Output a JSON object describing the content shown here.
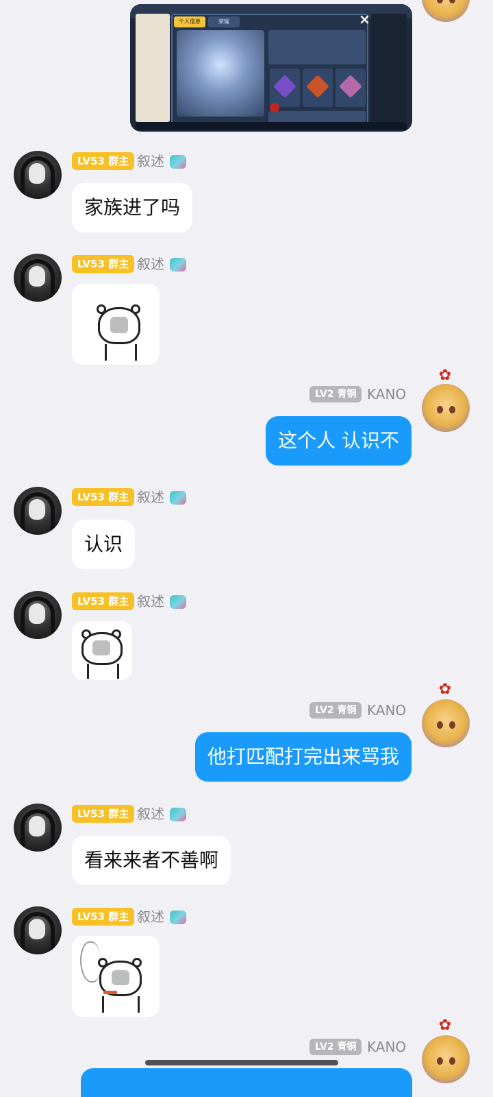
{
  "messages": [
    {
      "type": "image",
      "side": "out",
      "image_label": "game-screenshot"
    },
    {
      "type": "text",
      "side": "in",
      "badge": "LV53 群主",
      "sender": "叙述",
      "text": "家族进了吗"
    },
    {
      "type": "sticker",
      "side": "in",
      "badge": "LV53 群主",
      "sender": "叙述",
      "sticker": "bear-meme-sticker"
    },
    {
      "type": "text",
      "side": "out",
      "badge": "LV2 青铜",
      "sender": "KANO",
      "text": "这个人 认识不"
    },
    {
      "type": "text",
      "side": "in",
      "badge": "LV53 群主",
      "sender": "叙述",
      "text": "认识"
    },
    {
      "type": "sticker",
      "side": "in",
      "badge": "LV53 群主",
      "sender": "叙述",
      "sticker": "bear-meme-sticker"
    },
    {
      "type": "text",
      "side": "out",
      "badge": "LV2 青铜",
      "sender": "KANO",
      "text": "他打匹配打完出来骂我"
    },
    {
      "type": "text",
      "side": "in",
      "badge": "LV53 群主",
      "sender": "叙述",
      "text": "看来来者不善啊"
    },
    {
      "type": "sticker",
      "side": "in",
      "badge": "LV53 群主",
      "sender": "叙述",
      "sticker": "smoking-bear-meme-sticker"
    },
    {
      "type": "text",
      "side": "out",
      "badge": "LV2 青铜",
      "sender": "KANO",
      "text": ""
    }
  ],
  "colors": {
    "background": "#f1f1f5",
    "bubble_in": "#ffffff",
    "bubble_out": "#1a9bfb",
    "badge_group": "#f7c026",
    "badge_member": "#b5b5ba",
    "sender_name": "#8a8a8f"
  },
  "icons": {
    "left_avatar": "long-hair-portrait-avatar",
    "right_avatar": "anime-fox-girl-avatar",
    "right_decoration": "red-flower-icon",
    "name_decoration": "dino-badge-icon"
  }
}
